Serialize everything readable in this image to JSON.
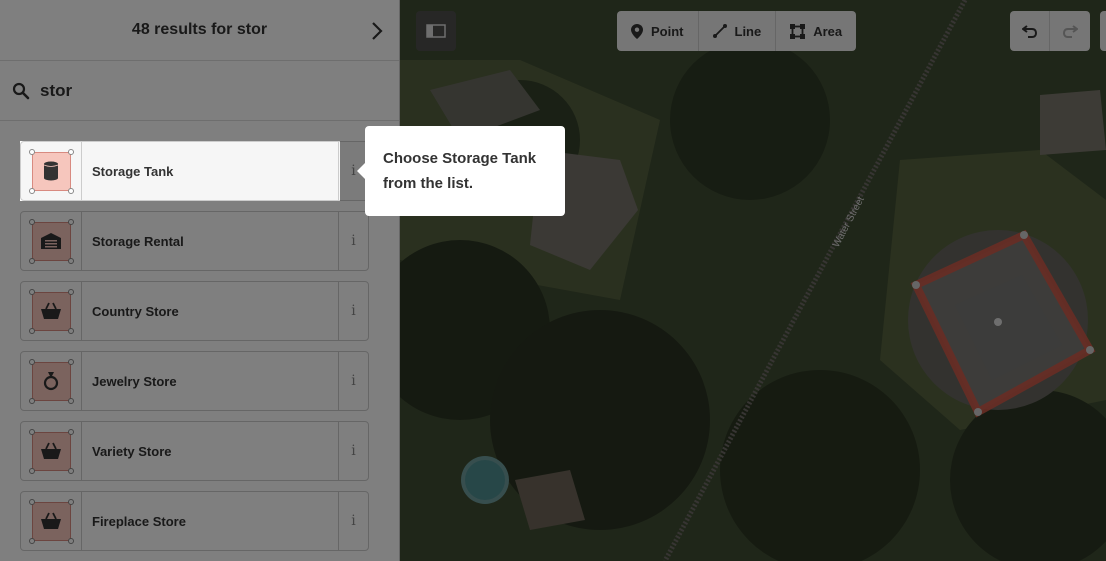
{
  "sidebar": {
    "title": "48 results for stor",
    "search": {
      "value": "stor",
      "placeholder": "Search"
    },
    "presets": [
      {
        "label": "Storage Tank",
        "icon": "storage-tank-icon",
        "info": "i"
      },
      {
        "label": "Storage Rental",
        "icon": "garage-icon",
        "info": "i"
      },
      {
        "label": "Country Store",
        "icon": "basket-icon",
        "info": "i"
      },
      {
        "label": "Jewelry Store",
        "icon": "ring-icon",
        "info": "i"
      },
      {
        "label": "Variety Store",
        "icon": "basket-icon",
        "info": "i"
      },
      {
        "label": "Fireplace Store",
        "icon": "basket-icon",
        "info": "i"
      }
    ]
  },
  "toolbar": {
    "modes": [
      {
        "label": "Point",
        "icon": "marker-icon"
      },
      {
        "label": "Line",
        "icon": "line-icon"
      },
      {
        "label": "Area",
        "icon": "area-icon"
      }
    ]
  },
  "map": {
    "street_label": "Water Street"
  },
  "walkthrough": {
    "tooltip_line1": "Choose Storage Tank",
    "tooltip_line2": "from the list."
  },
  "colors": {
    "area_fill": "#f6c6bd",
    "area_stroke": "#e06e5f",
    "shade": "rgba(0,0,0,0.5)"
  }
}
